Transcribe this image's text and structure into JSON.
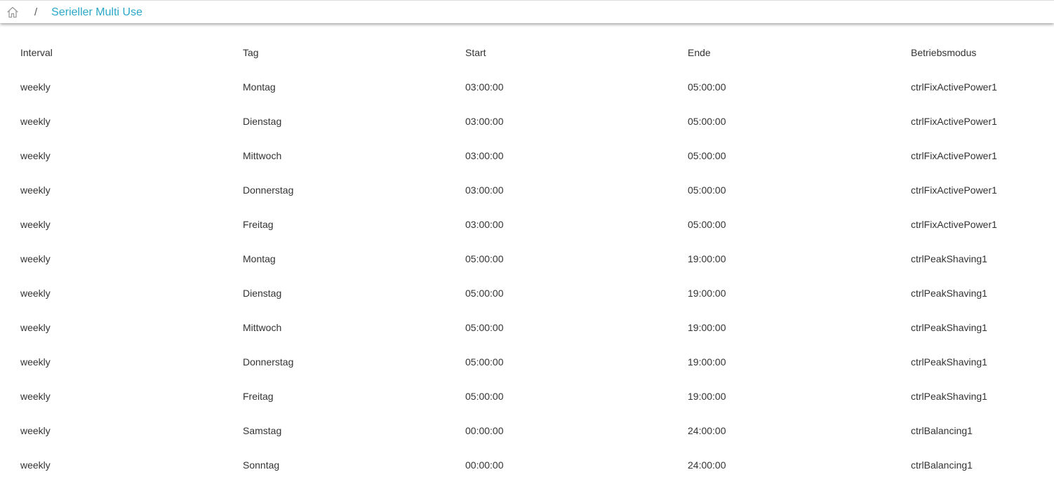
{
  "breadcrumb": {
    "separator": "/",
    "current": "Serieller Multi Use"
  },
  "table": {
    "headers": [
      "Interval",
      "Tag",
      "Start",
      "Ende",
      "Betriebsmodus"
    ],
    "rows": [
      [
        "weekly",
        "Montag",
        "03:00:00",
        "05:00:00",
        "ctrlFixActivePower1"
      ],
      [
        "weekly",
        "Dienstag",
        "03:00:00",
        "05:00:00",
        "ctrlFixActivePower1"
      ],
      [
        "weekly",
        "Mittwoch",
        "03:00:00",
        "05:00:00",
        "ctrlFixActivePower1"
      ],
      [
        "weekly",
        "Donnerstag",
        "03:00:00",
        "05:00:00",
        "ctrlFixActivePower1"
      ],
      [
        "weekly",
        "Freitag",
        "03:00:00",
        "05:00:00",
        "ctrlFixActivePower1"
      ],
      [
        "weekly",
        "Montag",
        "05:00:00",
        "19:00:00",
        "ctrlPeakShaving1"
      ],
      [
        "weekly",
        "Dienstag",
        "05:00:00",
        "19:00:00",
        "ctrlPeakShaving1"
      ],
      [
        "weekly",
        "Mittwoch",
        "05:00:00",
        "19:00:00",
        "ctrlPeakShaving1"
      ],
      [
        "weekly",
        "Donnerstag",
        "05:00:00",
        "19:00:00",
        "ctrlPeakShaving1"
      ],
      [
        "weekly",
        "Freitag",
        "05:00:00",
        "19:00:00",
        "ctrlPeakShaving1"
      ],
      [
        "weekly",
        "Samstag",
        "00:00:00",
        "24:00:00",
        "ctrlBalancing1"
      ],
      [
        "weekly",
        "Sonntag",
        "00:00:00",
        "24:00:00",
        "ctrlBalancing1"
      ]
    ]
  },
  "icons": {
    "home": "home-icon"
  },
  "colors": {
    "accent": "#2aa8c7",
    "text": "#333333",
    "icon": "#9a9a9a"
  }
}
